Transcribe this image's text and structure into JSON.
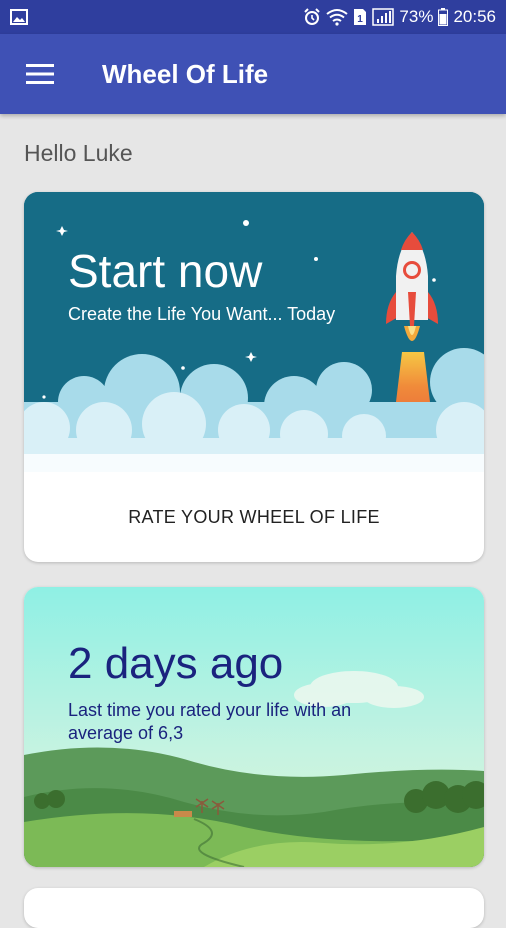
{
  "status_bar": {
    "battery": "73%",
    "time": "20:56",
    "icons": [
      "image-icon",
      "alarm-icon",
      "wifi-icon",
      "sim-icon",
      "signal-icon",
      "battery-icon"
    ]
  },
  "app_bar": {
    "title": "Wheel Of Life",
    "menu_icon": "menu-icon",
    "color": "#3f51b5"
  },
  "greeting": "Hello Luke",
  "cards": [
    {
      "title": "Start now",
      "subtitle": "Create the Life You Want... Today",
      "action": "RATE YOUR WHEEL OF LIFE",
      "illustration": "rocket-illustration"
    },
    {
      "title": "2 days ago",
      "subtitle": "Last time you rated your life with an average of 6,3",
      "illustration": "landscape-illustration"
    }
  ]
}
